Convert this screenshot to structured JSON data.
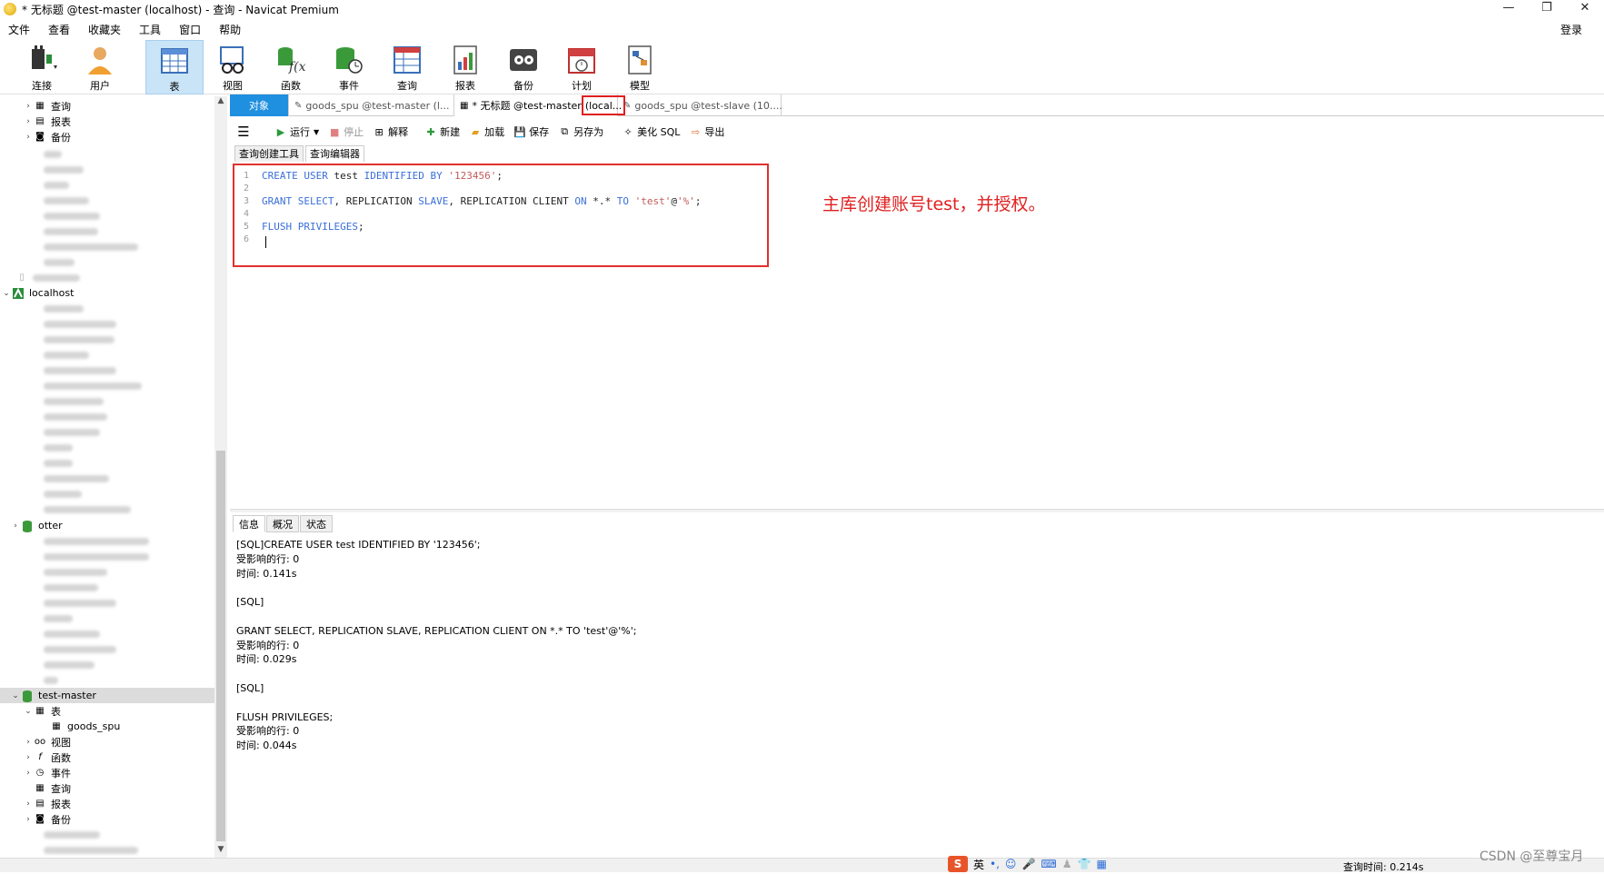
{
  "window": {
    "title": "* 无标题 @test-master (localhost) - 查询 - Navicat Premium",
    "controls": [
      "—",
      "❐",
      "✕"
    ]
  },
  "menu": [
    "文件",
    "查看",
    "收藏夹",
    "工具",
    "窗口",
    "帮助"
  ],
  "login": "登录",
  "toolbar": [
    {
      "label": "连接",
      "icon": "connection-icon"
    },
    {
      "label": "用户",
      "icon": "user-icon"
    },
    {
      "label": "表",
      "icon": "table-icon",
      "active": true
    },
    {
      "label": "视图",
      "icon": "view-icon"
    },
    {
      "label": "函数",
      "icon": "function-icon"
    },
    {
      "label": "事件",
      "icon": "event-icon"
    },
    {
      "label": "查询",
      "icon": "query-icon"
    },
    {
      "label": "报表",
      "icon": "report-icon"
    },
    {
      "label": "备份",
      "icon": "backup-icon"
    },
    {
      "label": "计划",
      "icon": "schedule-icon"
    },
    {
      "label": "模型",
      "icon": "model-icon"
    }
  ],
  "tree": {
    "top_items": [
      "查询",
      "报表",
      "备份"
    ],
    "connection_localhost": "localhost",
    "db_otter": "otter",
    "db_test_master": "test-master",
    "test_master_children": {
      "tables": "表",
      "table_goods_spu": "goods_spu",
      "views": "视图",
      "functions": "函数",
      "events": "事件",
      "queries": "查询",
      "reports": "报表",
      "backups": "备份"
    }
  },
  "tabs": {
    "objects": "对象",
    "tab1": "goods_spu @test-master (l...",
    "tab2_prefix": "* 无标题 @test-master",
    "tab2_highlight": "(local...",
    "tab3": "goods_spu @test-slave (10...."
  },
  "editor_toolbar": {
    "run": "运行",
    "stop": "停止",
    "explain": "解释",
    "new": "新建",
    "load": "加载",
    "save": "保存",
    "save_as": "另存为",
    "beautify": "美化 SQL",
    "export": "导出"
  },
  "subtabs": [
    "查询创建工具",
    "查询编辑器"
  ],
  "code": {
    "line_numbers": [
      "1",
      "2",
      "3",
      "4",
      "5",
      "6"
    ],
    "l1": {
      "k1": "CREATE",
      "k2": "USER",
      "t1": "test",
      "k3": "IDENTIFIED",
      "k4": "BY",
      "s1": "'123456'",
      "end": ";"
    },
    "l3": {
      "k1": "GRANT",
      "k2": "SELECT",
      "t1": ", REPLICATION",
      "k3": "SLAVE",
      "t2": ", REPLICATION CLIENT",
      "k4": "ON",
      "t3": "*.*",
      "k5": "TO",
      "s1": "'test'",
      "t4": "@",
      "s2": "'%'",
      "end": ";"
    },
    "l5": {
      "k1": "FLUSH",
      "k2": "PRIVILEGES",
      "end": ";"
    }
  },
  "annotation": "主库创建账号test，并授权。",
  "result_tabs": [
    "信息",
    "概况",
    "状态"
  ],
  "result_lines": [
    "[SQL]CREATE USER test IDENTIFIED BY '123456';",
    "受影响的行: 0",
    "时间: 0.141s",
    "",
    "[SQL]",
    "",
    "GRANT SELECT, REPLICATION SLAVE, REPLICATION CLIENT ON *.* TO 'test'@'%';",
    "受影响的行: 0",
    "时间: 0.029s",
    "",
    "[SQL]",
    "",
    "FLUSH PRIVILEGES;",
    "受影响的行: 0",
    "时间: 0.044s"
  ],
  "status": {
    "query_time": "查询时间: 0.214s"
  },
  "ime": {
    "logo": "S",
    "lang": "英"
  },
  "watermark": "CSDN @至尊宝月"
}
